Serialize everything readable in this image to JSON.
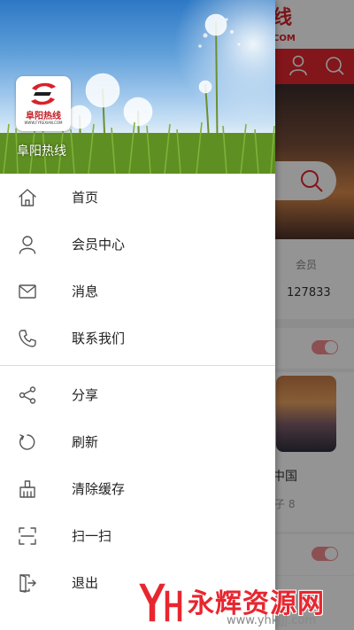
{
  "background_app": {
    "brand_text": "线",
    "brand_sub": "COM",
    "stats": {
      "label": "会员",
      "count": "127833"
    },
    "card": {
      "title": "中国",
      "subtitle": "子 8"
    }
  },
  "drawer": {
    "site_name": "阜阳热线",
    "logo": {
      "text": "阜阳热线",
      "url": "WWW.FYREXIAN.COM"
    },
    "menu_group_1": [
      {
        "label": "首页",
        "icon": "home-icon"
      },
      {
        "label": "会员中心",
        "icon": "user-icon"
      },
      {
        "label": "消息",
        "icon": "mail-icon"
      },
      {
        "label": "联系我们",
        "icon": "phone-icon"
      }
    ],
    "menu_group_2": [
      {
        "label": "分享",
        "icon": "share-icon"
      },
      {
        "label": "刷新",
        "icon": "refresh-icon"
      },
      {
        "label": "清除缓存",
        "icon": "broom-icon"
      },
      {
        "label": "扫一扫",
        "icon": "scan-icon"
      },
      {
        "label": "退出",
        "icon": "exit-icon"
      }
    ]
  },
  "watermark": {
    "title": "永辉资源网",
    "url": "www.yhkjjj.com"
  },
  "colors": {
    "accent": "#e0262e",
    "icon": "#555555",
    "text": "#222222"
  }
}
